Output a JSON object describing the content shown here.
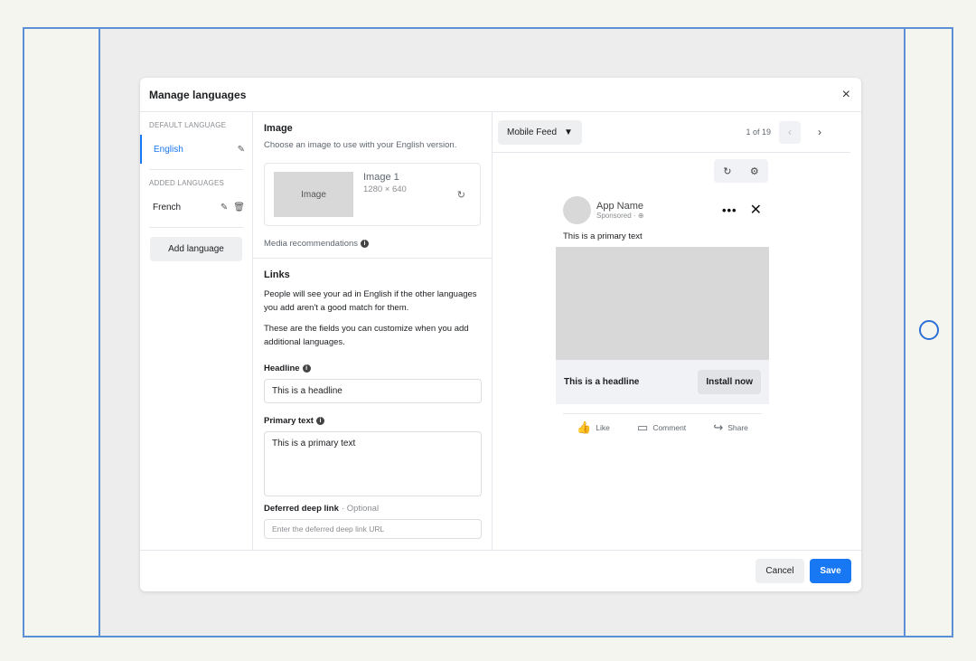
{
  "modal": {
    "title": "Manage languages",
    "close_icon": "×"
  },
  "languages": {
    "default_label": "DEFAULT LANGUAGE",
    "default_lang": "English",
    "added_label": "ADDED LANGUAGES",
    "added": [
      {
        "name": "French"
      }
    ],
    "add_button": "Add language"
  },
  "image_section": {
    "title": "Image",
    "subtitle": "Choose an image to use with your English version.",
    "thumb_label": "Image",
    "image_name": "Image 1",
    "image_size": "1280 × 640",
    "media_recommendations": "Media recommendations"
  },
  "links_section": {
    "title": "Links",
    "paragraph1": "People will see your ad in English if the other languages you add aren't a good match for them.",
    "paragraph2": "These are the fields you can customize when you add additional languages.",
    "headline_label": "Headline",
    "headline_value": "This is a headline",
    "primary_label": "Primary text",
    "primary_value": "This is a primary text",
    "deeplink_label": "Deferred deep link",
    "deeplink_optional": "· Optional",
    "deeplink_placeholder": "Enter the deferred deep link URL"
  },
  "preview": {
    "placement": "Mobile Feed",
    "pager": "1 of 19",
    "app_name": "App Name",
    "sponsored": "Sponsored · ",
    "primary_text": "This is a primary text",
    "headline": "This is a headline",
    "cta": "Install now",
    "reactions": [
      "Like",
      "Comment",
      "Share"
    ]
  },
  "footer": {
    "cancel": "Cancel",
    "save": "Save"
  },
  "colors": {
    "accent": "#1877f2",
    "frame": "#5b8fd6"
  }
}
